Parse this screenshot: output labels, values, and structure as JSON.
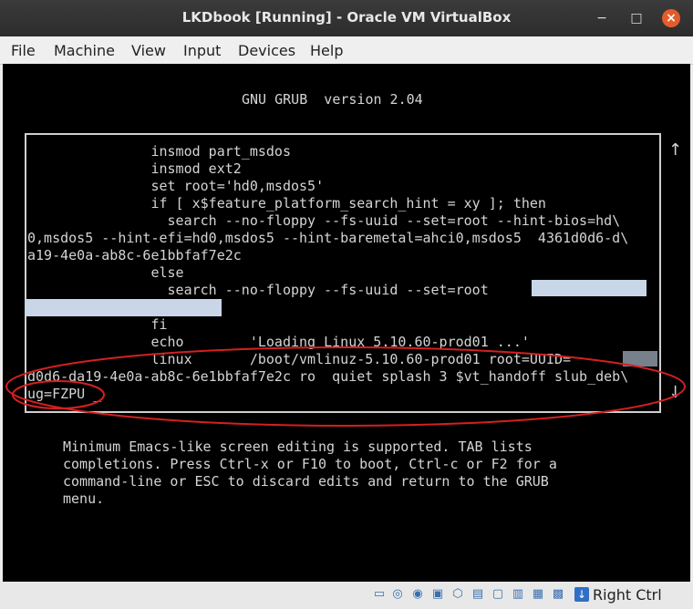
{
  "window": {
    "title": "LKDbook [Running] - Oracle VM VirtualBox",
    "controls": {
      "minimize": "−",
      "maximize": "□",
      "close": "×"
    }
  },
  "menubar": {
    "items": [
      "File",
      "Machine",
      "View",
      "Input",
      "Devices",
      "Help"
    ]
  },
  "grub": {
    "header": "GNU GRUB  version 2.04",
    "lines": [
      "               insmod part_msdos",
      "               insmod ext2",
      "               set root='hd0,msdos5'",
      "               if [ x$feature_platform_search_hint = xy ]; then",
      "                 search --no-floppy --fs-uuid --set=root --hint-bios=hd\\",
      "0,msdos5 --hint-efi=hd0,msdos5 --hint-baremetal=ahci0,msdos5  4361d0d6-d\\",
      "a19-4e0a-ab8c-6e1bbfaf7e2c",
      "               else",
      "                 search --no-floppy --fs-uuid --set=root               -\\",
      "",
      "               fi",
      "               echo        'Loading Linux 5.10.60-prod01 ...'",
      "               linux       /boot/vmlinuz-5.10.60-prod01 root=UUID=",
      "d0d6-da19-4e0a-ab8c-6e1bbfaf7e2c ro  quiet splash 3 $vt_handoff slub_deb\\",
      "ug=FZPU _"
    ],
    "scroll_up": "↑",
    "scroll_down": "↓",
    "help": [
      "Minimum Emacs-like screen editing is supported. TAB lists",
      "completions. Press Ctrl-x or F10 to boot, Ctrl-c or F2 for a",
      "command-line or ESC to discard edits and return to the GRUB",
      "menu."
    ]
  },
  "annotation": {
    "color": "#d42020"
  },
  "statusbar": {
    "icons": [
      "hard-disk-icon",
      "optical-drive-icon",
      "audio-icon",
      "network-icon",
      "usb-icon",
      "shared-folder-icon",
      "display-icon",
      "video-capture-icon",
      "recording-icon",
      "cpu-icon",
      "mouse-integration-icon"
    ],
    "host_key": "Right Ctrl",
    "host_key_arrow": "↓"
  }
}
